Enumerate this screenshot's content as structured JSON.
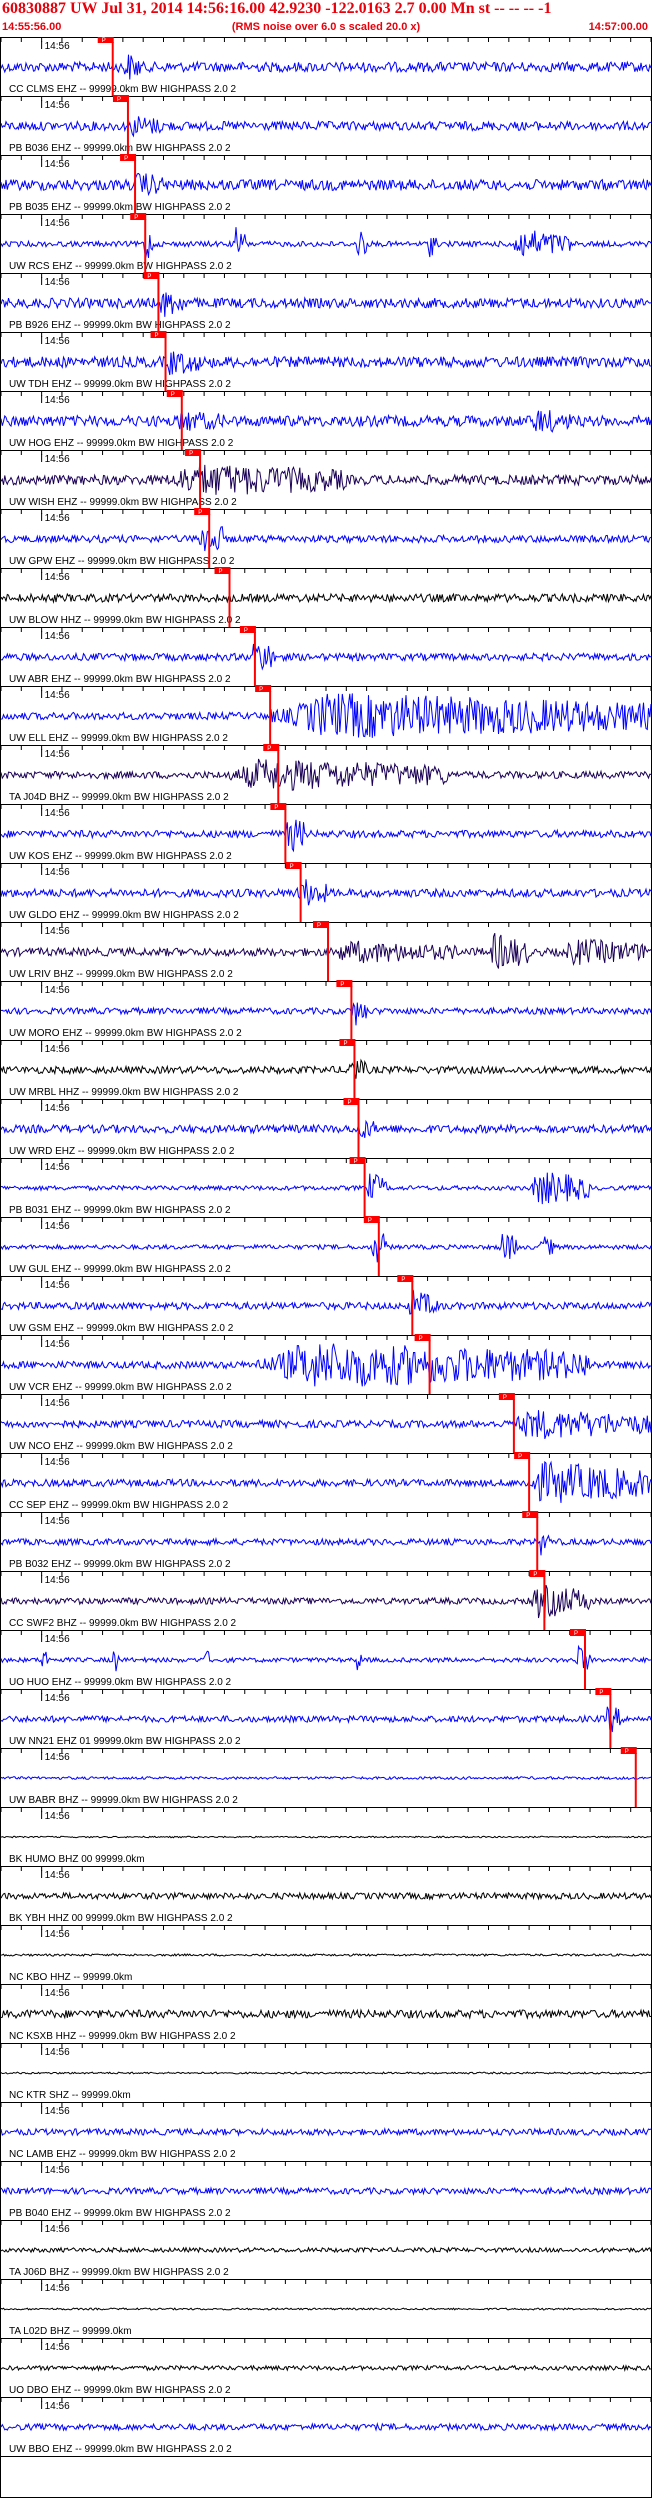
{
  "header": {
    "title": "60830887 UW Jul 31, 2014 14:56:16.00   42.9230  -122.0163  2.7  0.00 Mn st  -- -- --  -1",
    "subtitle": "(RMS noise over 6.0 s scaled 20.0 x)",
    "start_time": "14:55:56.00",
    "end_time": "14:57:00.00"
  },
  "colors": {
    "title": "#e8000b",
    "trace_blue": "#0000ff",
    "trace_purple": "#1a0055",
    "trace_black": "#000000",
    "pick_box": "#ff0000",
    "pick_line": "#ff0000",
    "grid": "#000000"
  },
  "chart_data": {
    "type": "seismogram-record-section",
    "time_range_s": [
      0,
      64
    ],
    "start_time": "14:55:56.00",
    "end_time": "14:57:00.00",
    "minute_mark_label": "14:56",
    "minute_tick_label": "14:56",
    "pick_label": "P",
    "tick_interval_s": 2,
    "traces": [
      {
        "label": "CC CLMS EHZ -- 99999.0km BW  HIGHPASS  2.0  2",
        "pick_s": 11.0,
        "color": "blue",
        "amp": 0.55,
        "events": [
          [
            12,
            14,
            0.8
          ]
        ]
      },
      {
        "label": "PB B036 EHZ -- 99999.0km BW  HIGHPASS  2.0  2",
        "pick_s": 12.5,
        "color": "blue",
        "amp": 0.5,
        "events": [
          [
            12.5,
            16,
            0.6
          ]
        ]
      },
      {
        "label": "PB B035 EHZ -- 99999.0km BW  HIGHPASS  2.0  2",
        "pick_s": 13.2,
        "color": "blue",
        "amp": 0.6,
        "events": [
          [
            13,
            16,
            0.7
          ]
        ]
      },
      {
        "label": "UW RCS EHZ -- 99999.0km BW  HIGHPASS  2.0  2",
        "pick_s": 14.2,
        "color": "blue",
        "amp": 0.3,
        "events": [
          [
            14,
            15,
            1.0
          ],
          [
            23,
            24,
            1.0
          ],
          [
            35,
            36,
            0.9
          ],
          [
            42,
            43,
            0.7
          ],
          [
            50,
            56,
            0.8
          ]
        ]
      },
      {
        "label": "PB B926 EHZ -- 99999.0km BW  HIGHPASS  2.0  2",
        "pick_s": 15.5,
        "color": "blue",
        "amp": 0.55,
        "events": [
          [
            15.5,
            18,
            0.8
          ]
        ]
      },
      {
        "label": "UW TDH EHZ -- 99999.0km BW  HIGHPASS  2.0  2",
        "pick_s": 16.2,
        "color": "blue",
        "amp": 0.6,
        "events": [
          [
            16,
            20,
            0.7
          ]
        ]
      },
      {
        "label": "UW HOG EHZ -- 99999.0km BW  HIGHPASS  2.0  2",
        "pick_s": 17.8,
        "color": "blue",
        "amp": 0.6,
        "events": [
          [
            17,
            22,
            0.6
          ],
          [
            52,
            56,
            0.7
          ]
        ]
      },
      {
        "label": "UW WISH EHZ -- 99999.0km BW  HIGHPASS  2.0  2",
        "pick_s": 19.6,
        "color": "purple",
        "amp": 0.55,
        "events": [
          [
            16,
            34,
            0.9
          ]
        ]
      },
      {
        "label": "UW GPW EHZ -- 99999.0km BW  HIGHPASS  2.0  2",
        "pick_s": 20.5,
        "color": "blue",
        "amp": 0.4,
        "events": [
          [
            19.5,
            22,
            1.0
          ]
        ]
      },
      {
        "label": "UW BLOW HHZ -- 99999.0km BW  HIGHPASS  2.0  2",
        "pick_s": 22.5,
        "color": "black",
        "amp": 0.45,
        "events": []
      },
      {
        "label": "UW ABR EHZ -- 99999.0km BW  HIGHPASS  2.0  2",
        "pick_s": 25.0,
        "color": "blue",
        "amp": 0.4,
        "events": [
          [
            24.5,
            27,
            0.9
          ]
        ]
      },
      {
        "label": "UW ELL EHZ -- 99999.0km BW  HIGHPASS  2.0  2",
        "pick_s": 26.5,
        "color": "blue",
        "amp": 0.4,
        "events": [
          [
            26.5,
            64,
            1.2
          ]
        ]
      },
      {
        "label": "TA J04D BHZ -- 99999.0km BW  HIGHPASS  2.0  2",
        "pick_s": 27.3,
        "color": "purple",
        "amp": 0.4,
        "events": [
          [
            22,
            44,
            0.85
          ]
        ]
      },
      {
        "label": "UW KOS EHZ -- 99999.0km BW  HIGHPASS  2.0  2",
        "pick_s": 28.0,
        "color": "blue",
        "amp": 0.4,
        "events": [
          [
            28,
            30,
            1.0
          ]
        ]
      },
      {
        "label": "UW GLDO EHZ -- 99999.0km BW  HIGHPASS  2.0  2",
        "pick_s": 29.5,
        "color": "blue",
        "amp": 0.45,
        "events": [
          [
            29,
            32,
            0.8
          ]
        ]
      },
      {
        "label": "UW LRIV BHZ -- 99999.0km BW  HIGHPASS  2.0  2",
        "pick_s": 32.2,
        "color": "purple",
        "amp": 0.45,
        "events": [
          [
            32,
            45,
            0.6
          ],
          [
            48,
            52,
            1.0
          ],
          [
            55,
            64,
            0.7
          ]
        ]
      },
      {
        "label": "UW MORO EHZ -- 99999.0km BW  HIGHPASS  2.0  2",
        "pick_s": 34.5,
        "color": "blue",
        "amp": 0.35,
        "events": [
          [
            34.5,
            36,
            0.8
          ]
        ]
      },
      {
        "label": "UW MRBL HHZ -- 99999.0km BW  HIGHPASS  2.0  2",
        "pick_s": 34.8,
        "color": "black",
        "amp": 0.4,
        "events": [
          [
            34,
            36,
            0.7
          ]
        ]
      },
      {
        "label": "UW WRD EHZ -- 99999.0km BW  HIGHPASS  2.0  2",
        "pick_s": 35.2,
        "color": "blue",
        "amp": 0.45,
        "events": [
          [
            35,
            37,
            0.6
          ]
        ]
      },
      {
        "label": "PB B031 EHZ -- 99999.0km BW  HIGHPASS  2.0  2",
        "pick_s": 35.8,
        "color": "blue",
        "amp": 0.25,
        "events": [
          [
            36,
            38,
            0.8
          ],
          [
            52,
            58,
            0.9
          ]
        ]
      },
      {
        "label": "UW GUL EHZ -- 99999.0km BW  HIGHPASS  2.0  2",
        "pick_s": 37.2,
        "color": "blue",
        "amp": 0.25,
        "events": [
          [
            36.5,
            38,
            1.0
          ],
          [
            49,
            51,
            0.8
          ],
          [
            53,
            54.5,
            0.6
          ]
        ]
      },
      {
        "label": "UW GSM EHZ -- 99999.0km BW  HIGHPASS  2.0  2",
        "pick_s": 40.5,
        "color": "blue",
        "amp": 0.4,
        "events": [
          [
            40,
            43,
            0.8
          ]
        ]
      },
      {
        "label": "UW VCR EHZ -- 99999.0km BW  HIGHPASS  2.0  2",
        "pick_s": 42.2,
        "color": "blue",
        "amp": 0.4,
        "events": [
          [
            25,
            58,
            1.2
          ]
        ]
      },
      {
        "label": "UW NCO EHZ -- 99999.0km BW  HIGHPASS  2.0  2",
        "pick_s": 50.5,
        "color": "blue",
        "amp": 0.4,
        "events": [
          [
            50,
            64,
            0.8
          ]
        ]
      },
      {
        "label": "CC SEP EHZ -- 99999.0km BW  HIGHPASS  2.0  2",
        "pick_s": 52.0,
        "color": "blue",
        "amp": 0.4,
        "events": [
          [
            51.5,
            64,
            1.1
          ]
        ]
      },
      {
        "label": "PB B032 EHZ -- 99999.0km BW  HIGHPASS  2.0  2",
        "pick_s": 52.8,
        "color": "blue",
        "amp": 0.35,
        "events": [
          [
            53,
            54,
            0.7
          ]
        ]
      },
      {
        "label": "CC SWF2 BHZ -- 99999.0km BW  HIGHPASS  2.0  2",
        "pick_s": 53.5,
        "color": "purple",
        "amp": 0.35,
        "events": [
          [
            52,
            58,
            0.9
          ]
        ]
      },
      {
        "label": "UO HUO EHZ -- 99999.0km BW  HIGHPASS  2.0  2",
        "pick_s": 57.5,
        "color": "blue",
        "amp": 0.25,
        "events": [
          [
            4,
            4.6,
            0.8
          ],
          [
            11,
            11.6,
            0.7
          ],
          [
            20,
            20.6,
            0.6
          ],
          [
            35,
            35.5,
            0.6
          ],
          [
            56.5,
            58,
            0.8
          ]
        ]
      },
      {
        "label": "UW NN21 EHZ 01 99999.0km BW  HIGHPASS  2.0  2",
        "pick_s": 60.0,
        "color": "blue",
        "amp": 0.35,
        "events": [
          [
            59.5,
            61,
            0.8
          ]
        ]
      },
      {
        "label": "UW BABR BHZ -- 99999.0km BW  HIGHPASS  2.0  2",
        "pick_s": 62.5,
        "color": "blue",
        "amp": 0.15,
        "events": []
      },
      {
        "label": "BK HUMO BHZ 00 99999.0km",
        "pick_s": null,
        "color": "black",
        "amp": 0.08,
        "events": []
      },
      {
        "label": "BK YBH HHZ 00 99999.0km BW  HIGHPASS  2.0  2",
        "pick_s": null,
        "color": "black",
        "amp": 0.35,
        "events": []
      },
      {
        "label": "NC KBO HHZ -- 99999.0km",
        "pick_s": null,
        "color": "black",
        "amp": 0.12,
        "events": []
      },
      {
        "label": "NC KSXB HHZ -- 99999.0km BW  HIGHPASS  2.0  2",
        "pick_s": null,
        "color": "black",
        "amp": 0.45,
        "events": []
      },
      {
        "label": "NC KTR SHZ -- 99999.0km",
        "pick_s": null,
        "color": "black",
        "amp": 0.1,
        "events": []
      },
      {
        "label": "NC LAMB EHZ -- 99999.0km BW  HIGHPASS  2.0  2",
        "pick_s": null,
        "color": "blue",
        "amp": 0.35,
        "events": []
      },
      {
        "label": "PB B040 EHZ -- 99999.0km BW  HIGHPASS  2.0  2",
        "pick_s": null,
        "color": "blue",
        "amp": 0.35,
        "events": []
      },
      {
        "label": "TA J06D BHZ -- 99999.0km BW  HIGHPASS  2.0  2",
        "pick_s": null,
        "color": "black",
        "amp": 0.25,
        "events": []
      },
      {
        "label": "TA L02D BHZ -- 99999.0km",
        "pick_s": null,
        "color": "black",
        "amp": 0.1,
        "events": []
      },
      {
        "label": "UO DBO EHZ -- 99999.0km BW  HIGHPASS  2.0  2",
        "pick_s": null,
        "color": "black",
        "amp": 0.25,
        "events": []
      },
      {
        "label": "UW BBO EHZ -- 99999.0km BW  HIGHPASS  2.0  2",
        "pick_s": null,
        "color": "blue",
        "amp": 0.35,
        "events": []
      }
    ]
  }
}
